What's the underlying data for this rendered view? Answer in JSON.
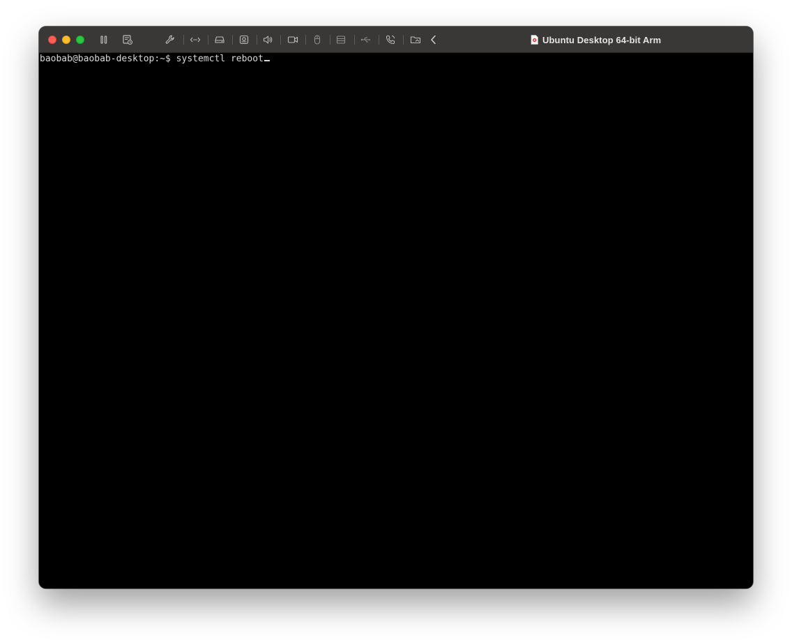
{
  "window": {
    "title": "Ubuntu Desktop 64-bit Arm"
  },
  "toolbar": {
    "icons": [
      "pause-icon",
      "snapshot-icon",
      "wrench-icon",
      "network-icon",
      "hard-disk-icon",
      "camera-device-icon",
      "sound-icon",
      "video-camera-icon",
      "mouse-icon",
      "printer-icon",
      "usb-icon",
      "phone-icon",
      "shared-folder-icon",
      "chevron-left-icon"
    ]
  },
  "terminal": {
    "prompt": "baobab@baobab-desktop:~$ ",
    "command": "systemctl reboot"
  },
  "colors": {
    "titlebar": "#3a3836",
    "terminal_bg": "#000000",
    "terminal_fg": "#d8d8d8",
    "close": "#fe5f57",
    "minimize": "#febc2e",
    "maximize": "#28c840"
  }
}
